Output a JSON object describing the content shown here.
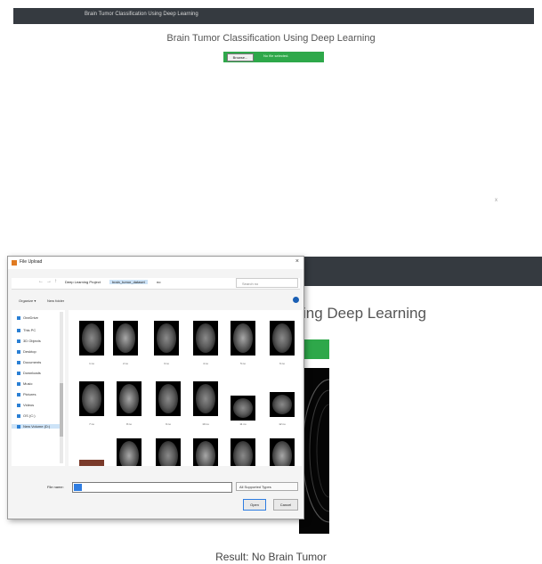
{
  "top": {
    "navbar_brand": "Brain Tumor Classification Using Deep Learning",
    "title": "Brain Tumor Classification Using Deep Learning",
    "choose_button": "Browse...",
    "file_status": "No file selected.",
    "stray_mark": "x"
  },
  "bottom": {
    "title_fragment": "ing Deep Learning",
    "result": "Result: No Brain Tumor"
  },
  "dialog": {
    "title": "File Upload",
    "close": "×",
    "nav_back": "←",
    "nav_forward": "→",
    "nav_up": "↑",
    "breadcrumbs": [
      "Deep Learning Project",
      "brain_tumor_dataset",
      "no"
    ],
    "search_placeholder": "Search no",
    "organize": "Organize ▾",
    "new_folder": "New folder",
    "sidebar": [
      "OneDrive",
      "This PC",
      "3D Objects",
      "Desktop",
      "Documents",
      "Downloads",
      "Music",
      "Pictures",
      "Videos",
      "OS (C:)",
      "New Volume (D:)"
    ],
    "files": [
      {
        "label": "1 no"
      },
      {
        "label": "2 no"
      },
      {
        "label": "3 no"
      },
      {
        "label": "4 no"
      },
      {
        "label": "5 no"
      },
      {
        "label": "6 no"
      },
      {
        "label": "7 no"
      },
      {
        "label": "8 no"
      },
      {
        "label": "9 no"
      },
      {
        "label": "10 no"
      },
      {
        "label": "11 no"
      },
      {
        "label": "12 no"
      },
      {
        "label": ""
      },
      {
        "label": ""
      },
      {
        "label": ""
      },
      {
        "label": ""
      },
      {
        "label": ""
      },
      {
        "label": ""
      }
    ],
    "file_name_label": "File name:",
    "file_name_value": "",
    "file_type": "All Supported Types",
    "open_button": "Open",
    "cancel_button": "Cancel"
  }
}
